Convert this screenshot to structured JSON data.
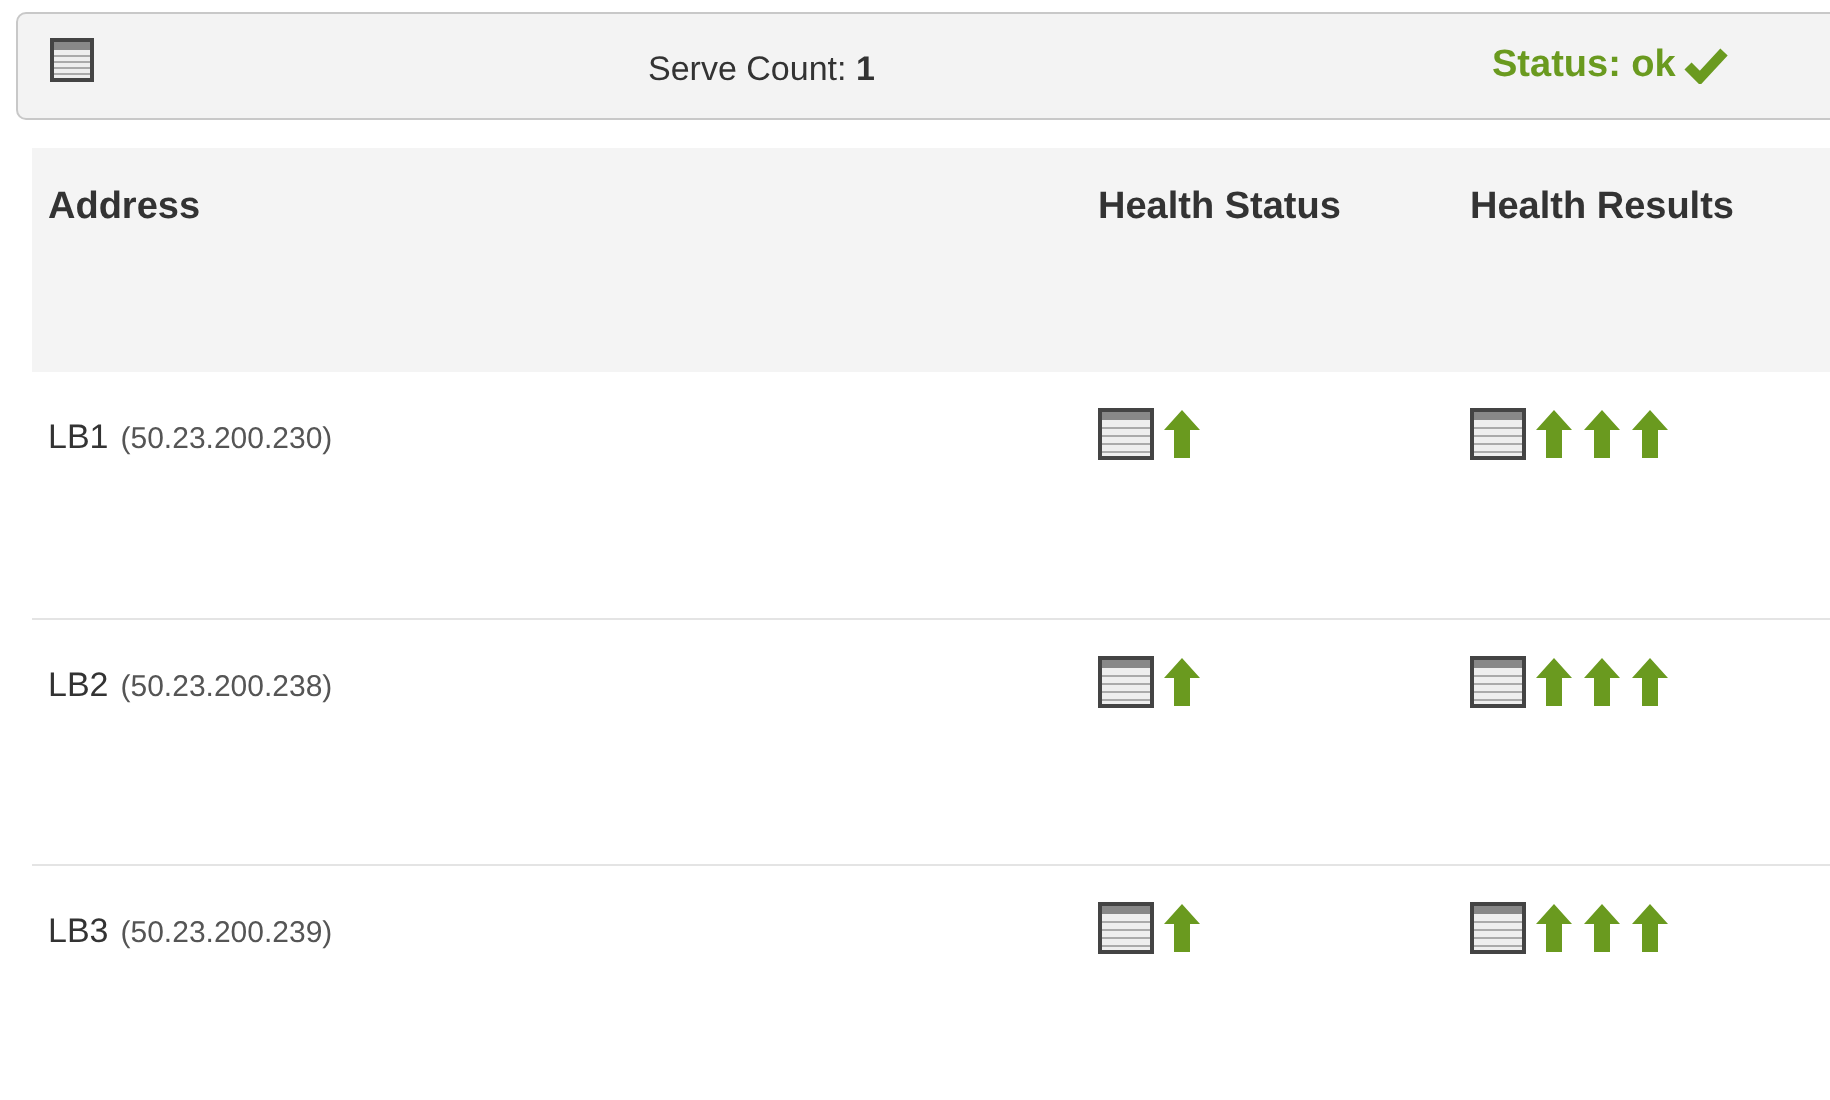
{
  "toolbar": {
    "serve_count": "Serve Count: **1**",
    "status": "Status: ok"
  },
  "table": {
    "columns": [
      "Address",
      "Health Status",
      "Health Results"
    ],
    "rows": [
      {
        "name": "LB1",
        "ip": "(50.23.200.230)",
        "health_status": {
          "up": true
        },
        "health_results": [
          {
            "up": true
          },
          {
            "up": true
          },
          {
            "up": true
          }
        ]
      },
      {
        "name": "LB2",
        "ip": "(50.23.200.238)",
        "health_status": {
          "up": true
        },
        "health_results": [
          {
            "up": true
          },
          {
            "up": true
          },
          {
            "up": true
          }
        ]
      },
      {
        "name": "LB3",
        "ip": "(50.23.200.239)",
        "health_status": {
          "up": true
        },
        "health_results": [
          {
            "up": true
          },
          {
            "up": true
          },
          {
            "up": true
          }
        ]
      }
    ]
  }
}
